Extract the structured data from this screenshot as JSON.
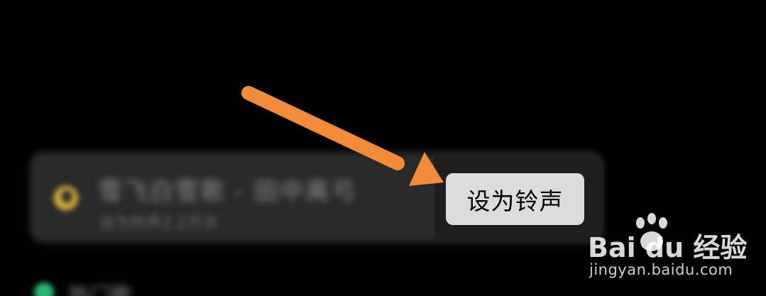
{
  "song_card": {
    "title": "雪飞白雪歌 - 田中离弓",
    "subtitle": "设为铃声2.2万次"
  },
  "ringtone_button": {
    "label": "设为铃声"
  },
  "bottom_item": {
    "label": "热门歌"
  },
  "watermark": {
    "brand": "Bai du 经验",
    "url": "jingyan.baidu.com"
  },
  "colors": {
    "background": "#000000",
    "card": "#2a2a2a",
    "button": "#dcdcdc",
    "arrow": "#f28c38",
    "icon": "#d9b43c",
    "green_dot": "#2bb673"
  }
}
